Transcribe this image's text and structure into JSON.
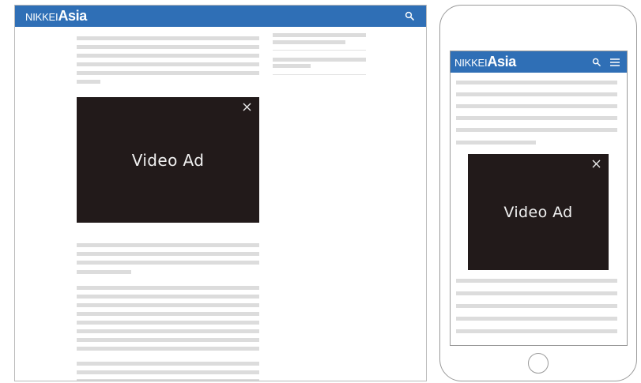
{
  "theme": {
    "brand_color": "#2f6fb6",
    "ad_color": "#221a1a",
    "placeholder_line_color": "#dcdcdc"
  },
  "brand": {
    "name_prefix": "NIKKEI",
    "name_main": "Asia"
  },
  "desktop": {
    "header": {
      "search_icon": "search-icon"
    },
    "video_ad": {
      "label": "Video Ad",
      "close_icon": "close-icon"
    }
  },
  "mobile": {
    "header": {
      "search_icon": "search-icon",
      "menu_icon": "hamburger-menu-icon"
    },
    "video_ad": {
      "label": "Video Ad",
      "close_icon": "close-icon"
    }
  }
}
